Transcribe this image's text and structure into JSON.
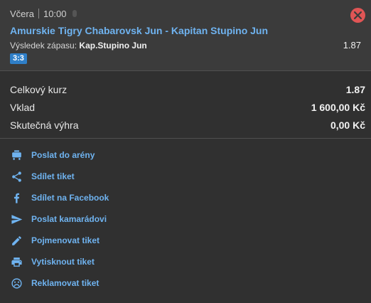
{
  "ticket": {
    "day": "Včera",
    "time": "10:00",
    "match": "Amurskie Tigry Chabarovsk Jun - Kapitan Stupino Jun",
    "result_label": "Výsledek zápasu:",
    "result_pick": "Kap.Stupino Jun",
    "odds": "1.87",
    "score": "3:3"
  },
  "summary": {
    "total_odds_label": "Celkový kurz",
    "total_odds_value": "1.87",
    "stake_label": "Vklad",
    "stake_value": "1 600,00 Kč",
    "win_label": "Skutečná výhra",
    "win_value": "0,00 Kč"
  },
  "actions": [
    {
      "label": "Poslat do arény",
      "icon": "arena-icon"
    },
    {
      "label": "Sdílet tiket",
      "icon": "share-icon"
    },
    {
      "label": "Sdílet na Facebook",
      "icon": "facebook-icon"
    },
    {
      "label": "Poslat kamarádovi",
      "icon": "send-icon"
    },
    {
      "label": "Pojmenovat tiket",
      "icon": "pencil-icon"
    },
    {
      "label": "Vytisknout tiket",
      "icon": "printer-icon"
    },
    {
      "label": "Reklamovat tiket",
      "icon": "sad-face-icon"
    }
  ],
  "colors": {
    "accent": "#6fb3f0",
    "close": "#e05555",
    "score_badge": "#2f7fc8",
    "background": "#303030"
  }
}
